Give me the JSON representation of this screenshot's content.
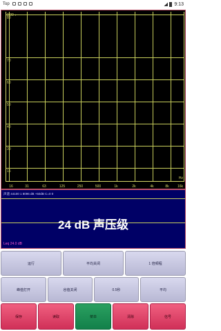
{
  "status_bar": {
    "time_left": "Top",
    "time_right": "9:13"
  },
  "analyzer": {
    "peak_label": "0.00 ↓",
    "y_labels": [
      "80",
      "70",
      "60",
      "50",
      "40",
      "30",
      "15"
    ],
    "x_labels": [
      "16",
      "31",
      "63",
      "125",
      "250",
      "500",
      "1k",
      "2k",
      "4k",
      "8k",
      "16k"
    ],
    "x_unit": "Hz"
  },
  "meter": {
    "info": "声道 44100 1 8096 dB +50dB C=0 0",
    "big_text": "24 dB 声压级",
    "leq": "Leq 24.0 dB"
  },
  "buttons": {
    "row1": [
      "运行",
      "平均关闭",
      "1  倍频程"
    ],
    "row2": [
      "峰值打开",
      "谷值关闭",
      "0.5秒",
      "平均"
    ],
    "row3": [
      "保存",
      "读取",
      "菜单",
      "清除",
      "信号"
    ]
  }
}
